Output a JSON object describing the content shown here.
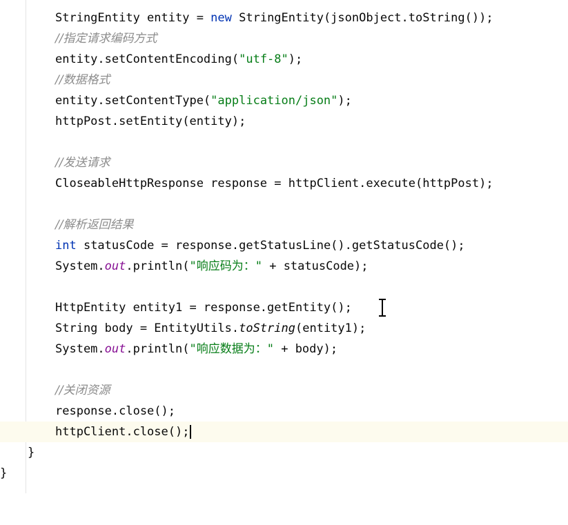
{
  "editor": {
    "lines": {
      "l1": {
        "a": "StringEntity entity = ",
        "kw": "new",
        "b": " StringEntity(jsonObject.toString());"
      },
      "l2": "//指定请求编码方式",
      "l3": {
        "a": "entity.setContentEncoding(",
        "str": "\"utf-8\"",
        "b": ");"
      },
      "l4": "//数据格式",
      "l5": {
        "a": "entity.setContentType(",
        "str": "\"application/json\"",
        "b": ");"
      },
      "l6": "httpPost.setEntity(entity);",
      "l8": "//发送请求",
      "l9": "CloseableHttpResponse response = httpClient.execute(httpPost);",
      "l11": "//解析返回结果",
      "l12": {
        "kw": "int",
        "b": " statusCode = response.getStatusLine().getStatusCode();"
      },
      "l13": {
        "a": "System.",
        "fld": "out",
        "b": ".println(",
        "str": "\"响应码为：\"",
        "c": " + statusCode);"
      },
      "l15": "HttpEntity entity1 = response.getEntity();",
      "l16": {
        "a": "String body = EntityUtils.",
        "ital": "toString",
        "b": "(entity1);"
      },
      "l17": {
        "a": "System.",
        "fld": "out",
        "b": ".println(",
        "str": "\"响应数据为：\"",
        "c": " + body);"
      },
      "l19": "//关闭资源",
      "l20": "response.close();",
      "l21": "httpClient.close();",
      "l22": "}",
      "l23": "}"
    }
  }
}
